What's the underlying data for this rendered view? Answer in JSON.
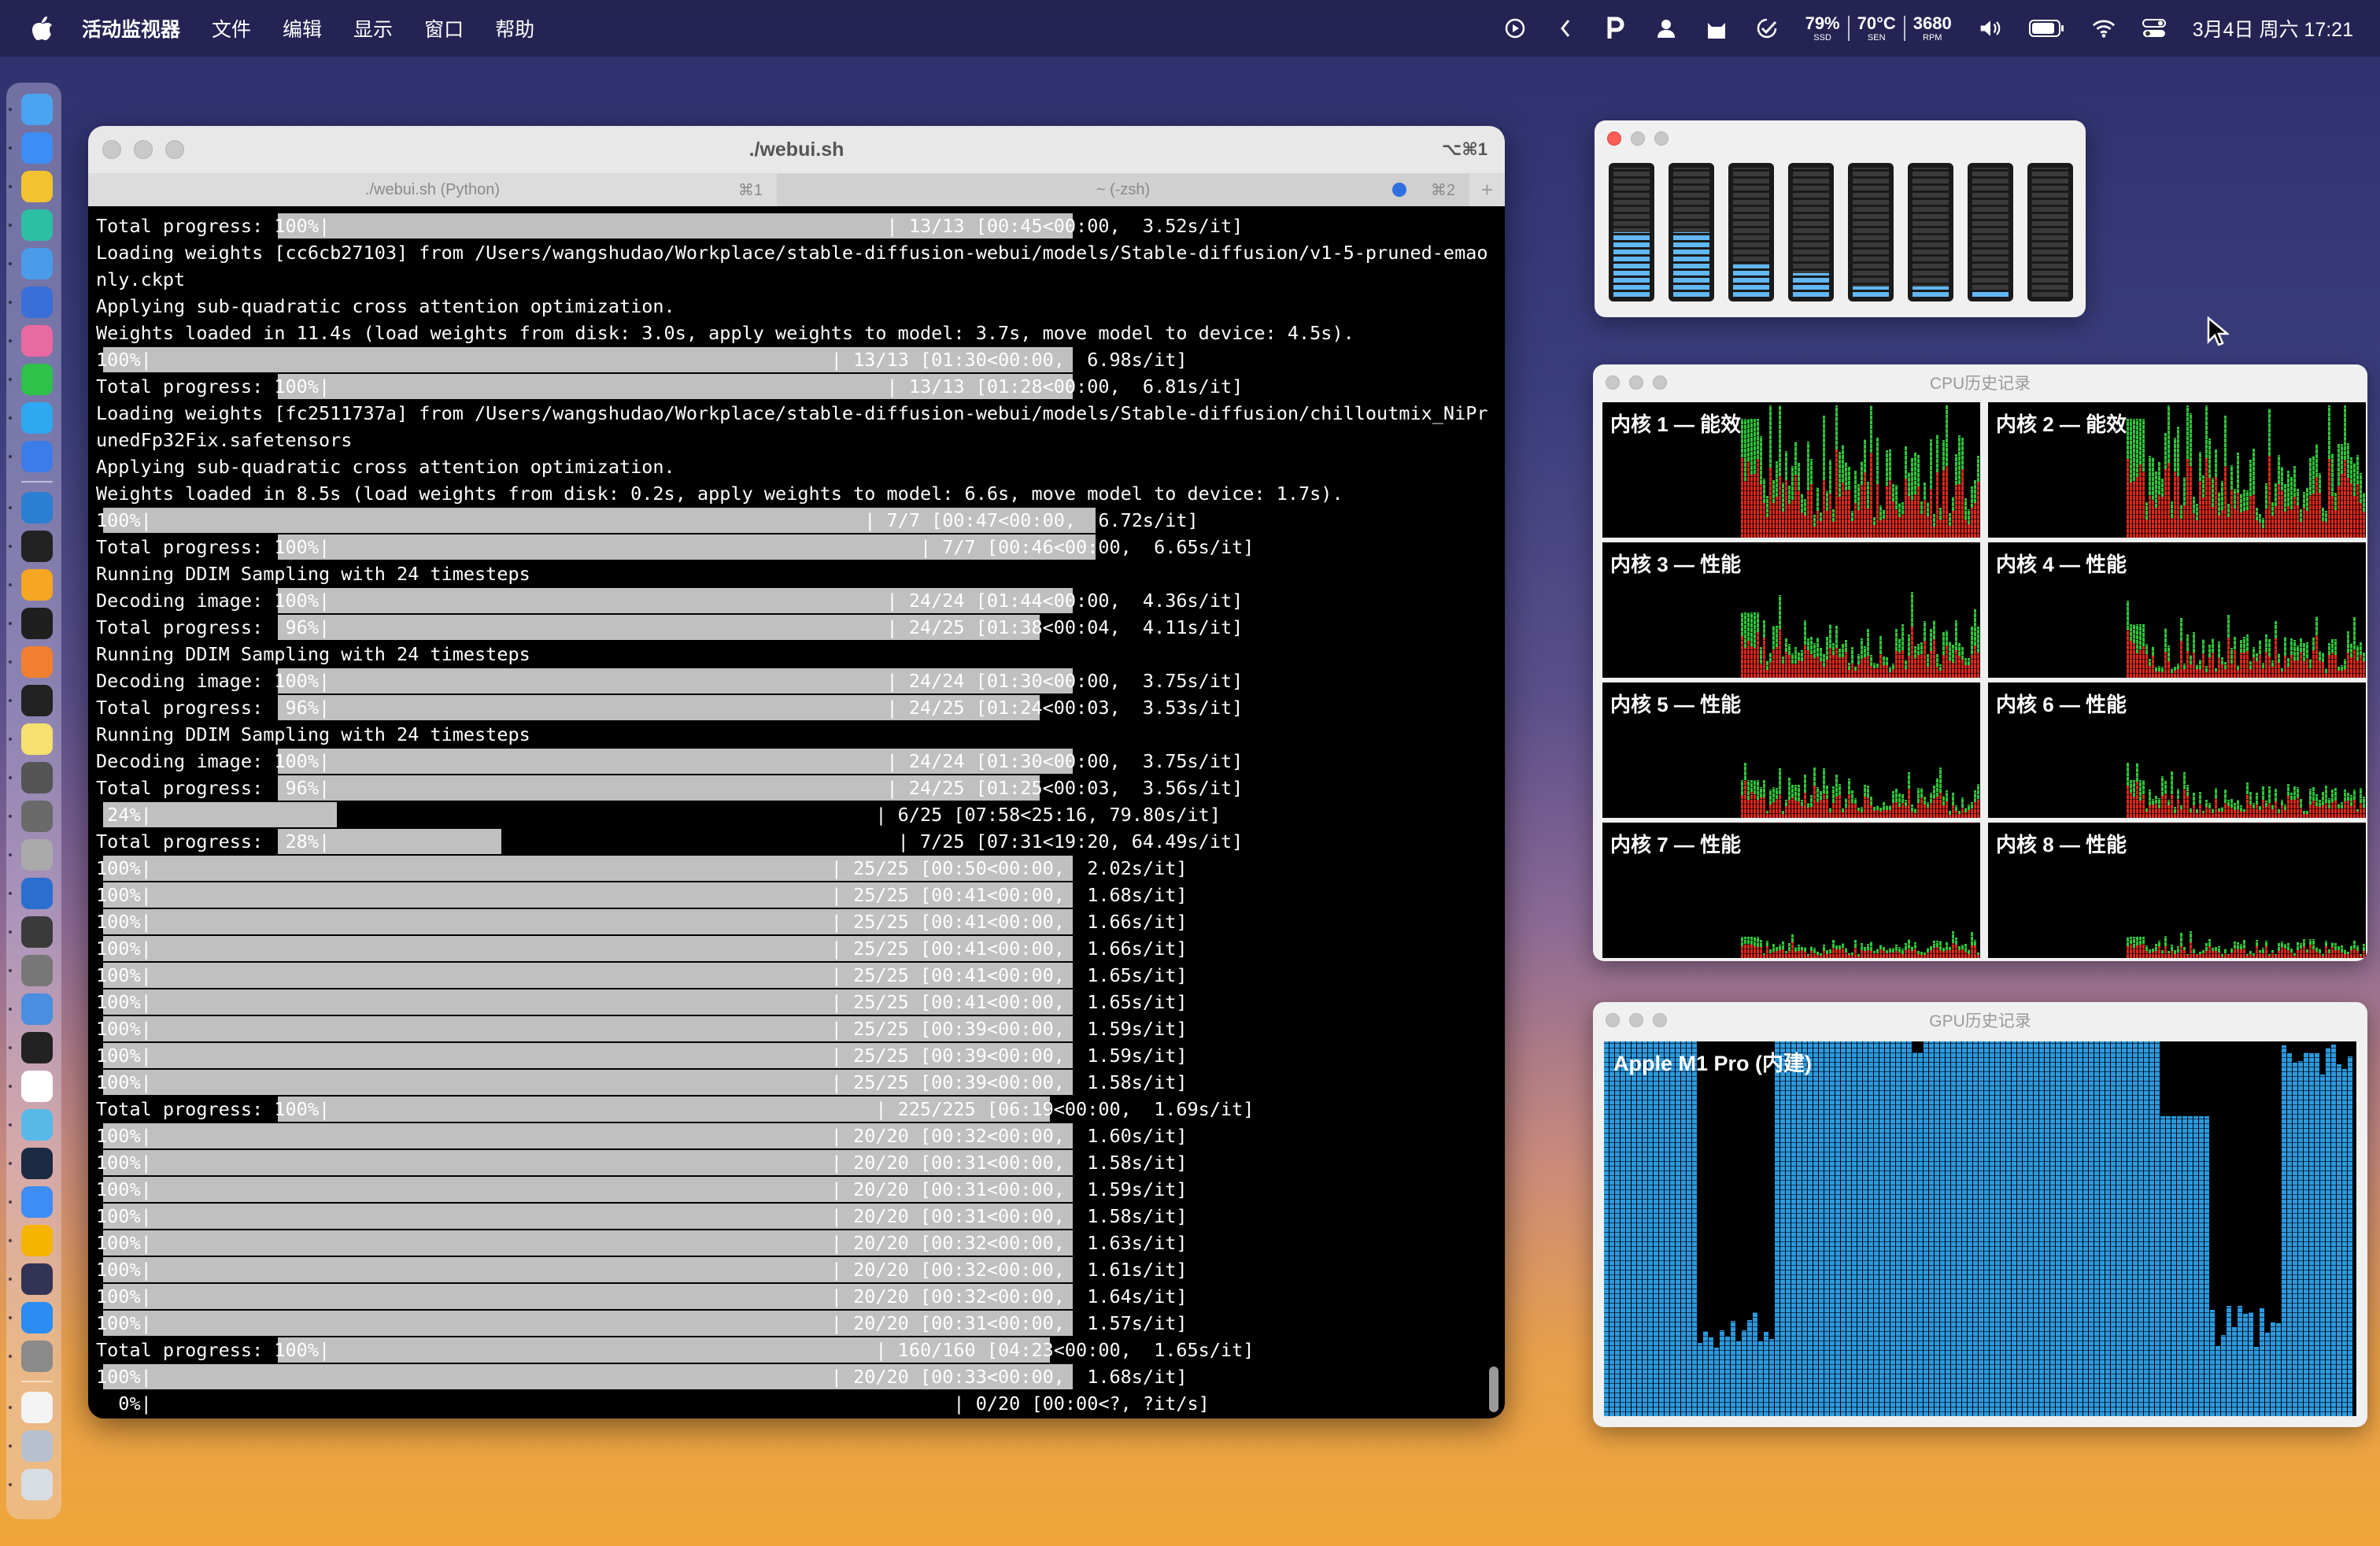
{
  "menubar": {
    "apple_icon": "apple-icon",
    "app_name": "活动监视器",
    "items": [
      "文件",
      "编辑",
      "显示",
      "窗口",
      "帮助"
    ],
    "status": {
      "ssd_value": "79%",
      "ssd_label": "SSD",
      "temp_value": "70°C",
      "temp_label": "SEN",
      "rpm_value": "3680",
      "rpm_label": "RPM",
      "clock": "3月4日 周六  17:21"
    }
  },
  "dock": {
    "icons": [
      {
        "name": "finder-icon",
        "color": "#4aa3f0"
      },
      {
        "name": "safari-icon",
        "color": "#3d8df5"
      },
      {
        "name": "chrome-icon",
        "color": "#f2c230"
      },
      {
        "name": "edge-icon",
        "color": "#2dbfa3"
      },
      {
        "name": "mail-icon",
        "color": "#4a9be8"
      },
      {
        "name": "cursor-app-icon",
        "color": "#3a6fd8"
      },
      {
        "name": "launchpad-icon",
        "color": "#e86aa0"
      },
      {
        "name": "wechat-icon",
        "color": "#2fc24a"
      },
      {
        "name": "qq-icon",
        "color": "#2ea8f0"
      },
      {
        "name": "xcode-icon",
        "color": "#3c7ce8"
      },
      {
        "name": "vscode-icon",
        "color": "#2a7fd4"
      },
      {
        "name": "terminal-icon",
        "color": "#222222"
      },
      {
        "name": "sketch-icon",
        "color": "#f5a623"
      },
      {
        "name": "activity-monitor-icon",
        "color": "#1f1f1f"
      },
      {
        "name": "books-icon",
        "color": "#f08030"
      },
      {
        "name": "figma-icon",
        "color": "#222222"
      },
      {
        "name": "notes-icon",
        "color": "#f5e070"
      },
      {
        "name": "sequel-icon",
        "color": "#555555"
      },
      {
        "name": "chatgpt-icon",
        "color": "#6a6a6a"
      },
      {
        "name": "instruments-icon",
        "color": "#aaaaaa"
      },
      {
        "name": "quicktime-icon",
        "color": "#2a6fd0"
      },
      {
        "name": "simulator-icon",
        "color": "#3a3a3a"
      },
      {
        "name": "calculator-icon",
        "color": "#777777"
      },
      {
        "name": "preview-icon",
        "color": "#4a8ee0"
      },
      {
        "name": "unity-icon",
        "color": "#222222"
      },
      {
        "name": "calendar-icon",
        "color": "#ffffff"
      },
      {
        "name": "photos-icon",
        "color": "#58b8e8"
      },
      {
        "name": "tv-icon",
        "color": "#1d2a44"
      },
      {
        "name": "network-icon",
        "color": "#3d8df5"
      },
      {
        "name": "chrome-canary-icon",
        "color": "#f4b400"
      },
      {
        "name": "obs-icon",
        "color": "#333355"
      },
      {
        "name": "app-store-icon",
        "color": "#2b8cf2"
      },
      {
        "name": "system-settings-icon",
        "color": "#8a8a8a"
      },
      {
        "name": "document-icon",
        "color": "#f4f4f4"
      },
      {
        "name": "downloads-icon",
        "color": "#b8c0d0"
      },
      {
        "name": "trash-icon",
        "color": "#d8dde4"
      }
    ]
  },
  "terminal": {
    "title": "./webui.sh",
    "title_shortcut": "⌥⌘1",
    "tab1_label": "./webui.sh (Python)",
    "tab1_shortcut": "⌘1",
    "tab2_label": "~ (-zsh)",
    "tab2_shortcut": "⌘2",
    "add_tab": "+",
    "lines": [
      {
        "text": "Total progress: 100%|                                                  | 13/13 [00:45<00:00,  3.52s/it]",
        "bar_start": 152,
        "bar_end": 677
      },
      {
        "text": "Loading weights [cc6cb27103] from /Users/wangshudao/Workplace/stable-diffusion-webui/models/Stable-diffusion/v1-5-pruned-emao"
      },
      {
        "text": "nly.ckpt"
      },
      {
        "text": "Applying sub-quadratic cross attention optimization."
      },
      {
        "text": "Weights loaded in 11.4s (load weights from disk: 3.0s, apply weights to model: 3.7s, move model to device: 4.5s)."
      },
      {
        "text": "100%|                                                             | 13/13 [01:30<00:00,  6.98s/it]",
        "bar_start": 37,
        "bar_end": 677
      },
      {
        "text": "Total progress: 100%|                                                  | 13/13 [01:28<00:00,  6.81s/it]",
        "bar_start": 152,
        "bar_end": 677
      },
      {
        "text": "Loading weights [fc2511737a] from /Users/wangshudao/Workplace/stable-diffusion-webui/models/Stable-diffusion/chilloutmix_NiPr"
      },
      {
        "text": "unedFp32Fix.safetensors"
      },
      {
        "text": "Applying sub-quadratic cross attention optimization."
      },
      {
        "text": "Weights loaded in 8.5s (load weights from disk: 0.2s, apply weights to model: 6.6s, move model to device: 1.7s)."
      },
      {
        "text": "100%|                                                                | 7/7 [00:47<00:00,  6.72s/it]",
        "bar_start": 37,
        "bar_end": 692
      },
      {
        "text": "Total progress: 100%|                                                     | 7/7 [00:46<00:00,  6.65s/it]",
        "bar_start": 152,
        "bar_end": 692
      },
      {
        "text": "Running DDIM Sampling with 24 timesteps"
      },
      {
        "text": "Decoding image: 100%|                                                  | 24/24 [01:44<00:00,  4.36s/it]",
        "bar_start": 152,
        "bar_end": 677
      },
      {
        "text": "Total progress:  96%|                                                  | 24/25 [01:38<00:04,  4.11s/it]",
        "bar_start": 152,
        "bar_end": 655
      },
      {
        "text": "Running DDIM Sampling with 24 timesteps"
      },
      {
        "text": "Decoding image: 100%|                                                  | 24/24 [01:30<00:00,  3.75s/it]",
        "bar_start": 152,
        "bar_end": 677
      },
      {
        "text": "Total progress:  96%|                                                  | 24/25 [01:24<00:03,  3.53s/it]",
        "bar_start": 152,
        "bar_end": 655
      },
      {
        "text": "Running DDIM Sampling with 24 timesteps"
      },
      {
        "text": "Decoding image: 100%|                                                  | 24/24 [01:30<00:00,  3.75s/it]",
        "bar_start": 152,
        "bar_end": 677
      },
      {
        "text": "Total progress:  96%|                                                  | 24/25 [01:25<00:03,  3.56s/it]",
        "bar_start": 152,
        "bar_end": 655
      },
      {
        "text": " 24%|                                                                 | 6/25 [07:58<25:16, 79.80s/it]",
        "bar_start": 37,
        "bar_end": 191
      },
      {
        "text": "Total progress:  28%|                                                   | 7/25 [07:31<19:20, 64.49s/it]",
        "bar_start": 152,
        "bar_end": 300
      },
      {
        "text": "100%|                                                             | 25/25 [00:50<00:00,  2.02s/it]",
        "bar_start": 37,
        "bar_end": 677
      },
      {
        "text": "100%|                                                             | 25/25 [00:41<00:00,  1.68s/it]",
        "bar_start": 37,
        "bar_end": 677
      },
      {
        "text": "100%|                                                             | 25/25 [00:41<00:00,  1.66s/it]",
        "bar_start": 37,
        "bar_end": 677
      },
      {
        "text": "100%|                                                             | 25/25 [00:41<00:00,  1.66s/it]",
        "bar_start": 37,
        "bar_end": 677
      },
      {
        "text": "100%|                                                             | 25/25 [00:41<00:00,  1.65s/it]",
        "bar_start": 37,
        "bar_end": 677
      },
      {
        "text": "100%|                                                             | 25/25 [00:41<00:00,  1.65s/it]",
        "bar_start": 37,
        "bar_end": 677
      },
      {
        "text": "100%|                                                             | 25/25 [00:39<00:00,  1.59s/it]",
        "bar_start": 37,
        "bar_end": 677
      },
      {
        "text": "100%|                                                             | 25/25 [00:39<00:00,  1.59s/it]",
        "bar_start": 37,
        "bar_end": 677
      },
      {
        "text": "100%|                                                             | 25/25 [00:39<00:00,  1.58s/it]",
        "bar_start": 37,
        "bar_end": 677
      },
      {
        "text": "Total progress: 100%|                                                 | 225/225 [06:19<00:00,  1.69s/it]",
        "bar_start": 152,
        "bar_end": 662
      },
      {
        "text": "100%|                                                             | 20/20 [00:32<00:00,  1.60s/it]",
        "bar_start": 37,
        "bar_end": 677
      },
      {
        "text": "100%|                                                             | 20/20 [00:31<00:00,  1.58s/it]",
        "bar_start": 37,
        "bar_end": 677
      },
      {
        "text": "100%|                                                             | 20/20 [00:31<00:00,  1.59s/it]",
        "bar_start": 37,
        "bar_end": 677
      },
      {
        "text": "100%|                                                             | 20/20 [00:31<00:00,  1.58s/it]",
        "bar_start": 37,
        "bar_end": 677
      },
      {
        "text": "100%|                                                             | 20/20 [00:32<00:00,  1.63s/it]",
        "bar_start": 37,
        "bar_end": 677
      },
      {
        "text": "100%|                                                             | 20/20 [00:32<00:00,  1.61s/it]",
        "bar_start": 37,
        "bar_end": 677
      },
      {
        "text": "100%|                                                             | 20/20 [00:32<00:00,  1.64s/it]",
        "bar_start": 37,
        "bar_end": 677
      },
      {
        "text": "100%|                                                             | 20/20 [00:31<00:00,  1.57s/it]",
        "bar_start": 37,
        "bar_end": 677
      },
      {
        "text": "Total progress: 100%|                                                 | 160/160 [04:23<00:00,  1.65s/it]",
        "bar_start": 152,
        "bar_end": 662
      },
      {
        "text": "100%|                                                             | 20/20 [00:33<00:00,  1.68s/it]",
        "bar_start": 37,
        "bar_end": 677
      },
      {
        "text": "  0%|                                                                        | 0/20 [00:00<?, ?it/s]"
      }
    ]
  },
  "cpu_usage_window": {
    "levels": [
      0.5,
      0.5,
      0.25,
      0.18,
      0.08,
      0.08,
      0.05,
      0.0
    ]
  },
  "cpu_history": {
    "title": "CPU历史记录",
    "cores": [
      {
        "label": "内核 1 — 能效"
      },
      {
        "label": "内核 2 — 能效"
      },
      {
        "label": "内核 3 — 性能"
      },
      {
        "label": "内核 4 — 性能"
      },
      {
        "label": "内核 5 — 性能"
      },
      {
        "label": "内核 6 — 性能"
      },
      {
        "label": "内核 7 — 性能"
      },
      {
        "label": "内核 8 — 性能"
      }
    ]
  },
  "gpu_history": {
    "title": "GPU历史记录",
    "gpu_name": "Apple M1 Pro (内建)"
  }
}
